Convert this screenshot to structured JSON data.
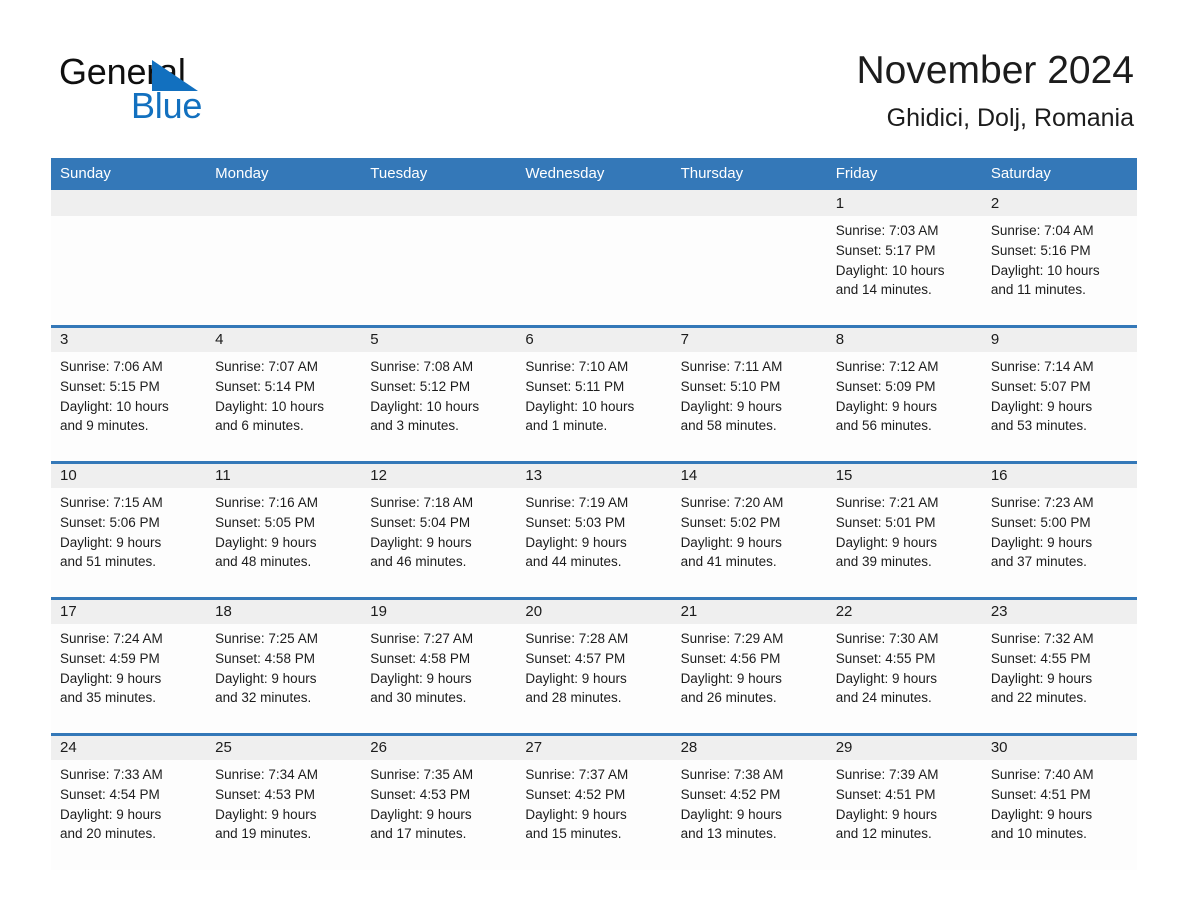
{
  "brand": {
    "name_part1": "General",
    "name_part2": "Blue",
    "triangle_color": "#1270bf",
    "text_color": "#0f0f0f"
  },
  "header": {
    "title": "November 2024",
    "location": "Ghidici, Dolj, Romania"
  },
  "colors": {
    "header_band": "#3478b8",
    "daynum_band": "#efefef",
    "cell_background": "#fdfdfd",
    "text": "#1c1c1c",
    "header_text": "#ffffff"
  },
  "weekday_headers": [
    "Sunday",
    "Monday",
    "Tuesday",
    "Wednesday",
    "Thursday",
    "Friday",
    "Saturday"
  ],
  "weeks": [
    {
      "days": [
        {
          "day": "",
          "sunrise": "",
          "sunset": "",
          "daylight1": "",
          "daylight2": ""
        },
        {
          "day": "",
          "sunrise": "",
          "sunset": "",
          "daylight1": "",
          "daylight2": ""
        },
        {
          "day": "",
          "sunrise": "",
          "sunset": "",
          "daylight1": "",
          "daylight2": ""
        },
        {
          "day": "",
          "sunrise": "",
          "sunset": "",
          "daylight1": "",
          "daylight2": ""
        },
        {
          "day": "",
          "sunrise": "",
          "sunset": "",
          "daylight1": "",
          "daylight2": ""
        },
        {
          "day": "1",
          "sunrise": "Sunrise: 7:03 AM",
          "sunset": "Sunset: 5:17 PM",
          "daylight1": "Daylight: 10 hours",
          "daylight2": "and 14 minutes."
        },
        {
          "day": "2",
          "sunrise": "Sunrise: 7:04 AM",
          "sunset": "Sunset: 5:16 PM",
          "daylight1": "Daylight: 10 hours",
          "daylight2": "and 11 minutes."
        }
      ]
    },
    {
      "days": [
        {
          "day": "3",
          "sunrise": "Sunrise: 7:06 AM",
          "sunset": "Sunset: 5:15 PM",
          "daylight1": "Daylight: 10 hours",
          "daylight2": "and 9 minutes."
        },
        {
          "day": "4",
          "sunrise": "Sunrise: 7:07 AM",
          "sunset": "Sunset: 5:14 PM",
          "daylight1": "Daylight: 10 hours",
          "daylight2": "and 6 minutes."
        },
        {
          "day": "5",
          "sunrise": "Sunrise: 7:08 AM",
          "sunset": "Sunset: 5:12 PM",
          "daylight1": "Daylight: 10 hours",
          "daylight2": "and 3 minutes."
        },
        {
          "day": "6",
          "sunrise": "Sunrise: 7:10 AM",
          "sunset": "Sunset: 5:11 PM",
          "daylight1": "Daylight: 10 hours",
          "daylight2": "and 1 minute."
        },
        {
          "day": "7",
          "sunrise": "Sunrise: 7:11 AM",
          "sunset": "Sunset: 5:10 PM",
          "daylight1": "Daylight: 9 hours",
          "daylight2": "and 58 minutes."
        },
        {
          "day": "8",
          "sunrise": "Sunrise: 7:12 AM",
          "sunset": "Sunset: 5:09 PM",
          "daylight1": "Daylight: 9 hours",
          "daylight2": "and 56 minutes."
        },
        {
          "day": "9",
          "sunrise": "Sunrise: 7:14 AM",
          "sunset": "Sunset: 5:07 PM",
          "daylight1": "Daylight: 9 hours",
          "daylight2": "and 53 minutes."
        }
      ]
    },
    {
      "days": [
        {
          "day": "10",
          "sunrise": "Sunrise: 7:15 AM",
          "sunset": "Sunset: 5:06 PM",
          "daylight1": "Daylight: 9 hours",
          "daylight2": "and 51 minutes."
        },
        {
          "day": "11",
          "sunrise": "Sunrise: 7:16 AM",
          "sunset": "Sunset: 5:05 PM",
          "daylight1": "Daylight: 9 hours",
          "daylight2": "and 48 minutes."
        },
        {
          "day": "12",
          "sunrise": "Sunrise: 7:18 AM",
          "sunset": "Sunset: 5:04 PM",
          "daylight1": "Daylight: 9 hours",
          "daylight2": "and 46 minutes."
        },
        {
          "day": "13",
          "sunrise": "Sunrise: 7:19 AM",
          "sunset": "Sunset: 5:03 PM",
          "daylight1": "Daylight: 9 hours",
          "daylight2": "and 44 minutes."
        },
        {
          "day": "14",
          "sunrise": "Sunrise: 7:20 AM",
          "sunset": "Sunset: 5:02 PM",
          "daylight1": "Daylight: 9 hours",
          "daylight2": "and 41 minutes."
        },
        {
          "day": "15",
          "sunrise": "Sunrise: 7:21 AM",
          "sunset": "Sunset: 5:01 PM",
          "daylight1": "Daylight: 9 hours",
          "daylight2": "and 39 minutes."
        },
        {
          "day": "16",
          "sunrise": "Sunrise: 7:23 AM",
          "sunset": "Sunset: 5:00 PM",
          "daylight1": "Daylight: 9 hours",
          "daylight2": "and 37 minutes."
        }
      ]
    },
    {
      "days": [
        {
          "day": "17",
          "sunrise": "Sunrise: 7:24 AM",
          "sunset": "Sunset: 4:59 PM",
          "daylight1": "Daylight: 9 hours",
          "daylight2": "and 35 minutes."
        },
        {
          "day": "18",
          "sunrise": "Sunrise: 7:25 AM",
          "sunset": "Sunset: 4:58 PM",
          "daylight1": "Daylight: 9 hours",
          "daylight2": "and 32 minutes."
        },
        {
          "day": "19",
          "sunrise": "Sunrise: 7:27 AM",
          "sunset": "Sunset: 4:58 PM",
          "daylight1": "Daylight: 9 hours",
          "daylight2": "and 30 minutes."
        },
        {
          "day": "20",
          "sunrise": "Sunrise: 7:28 AM",
          "sunset": "Sunset: 4:57 PM",
          "daylight1": "Daylight: 9 hours",
          "daylight2": "and 28 minutes."
        },
        {
          "day": "21",
          "sunrise": "Sunrise: 7:29 AM",
          "sunset": "Sunset: 4:56 PM",
          "daylight1": "Daylight: 9 hours",
          "daylight2": "and 26 minutes."
        },
        {
          "day": "22",
          "sunrise": "Sunrise: 7:30 AM",
          "sunset": "Sunset: 4:55 PM",
          "daylight1": "Daylight: 9 hours",
          "daylight2": "and 24 minutes."
        },
        {
          "day": "23",
          "sunrise": "Sunrise: 7:32 AM",
          "sunset": "Sunset: 4:55 PM",
          "daylight1": "Daylight: 9 hours",
          "daylight2": "and 22 minutes."
        }
      ]
    },
    {
      "days": [
        {
          "day": "24",
          "sunrise": "Sunrise: 7:33 AM",
          "sunset": "Sunset: 4:54 PM",
          "daylight1": "Daylight: 9 hours",
          "daylight2": "and 20 minutes."
        },
        {
          "day": "25",
          "sunrise": "Sunrise: 7:34 AM",
          "sunset": "Sunset: 4:53 PM",
          "daylight1": "Daylight: 9 hours",
          "daylight2": "and 19 minutes."
        },
        {
          "day": "26",
          "sunrise": "Sunrise: 7:35 AM",
          "sunset": "Sunset: 4:53 PM",
          "daylight1": "Daylight: 9 hours",
          "daylight2": "and 17 minutes."
        },
        {
          "day": "27",
          "sunrise": "Sunrise: 7:37 AM",
          "sunset": "Sunset: 4:52 PM",
          "daylight1": "Daylight: 9 hours",
          "daylight2": "and 15 minutes."
        },
        {
          "day": "28",
          "sunrise": "Sunrise: 7:38 AM",
          "sunset": "Sunset: 4:52 PM",
          "daylight1": "Daylight: 9 hours",
          "daylight2": "and 13 minutes."
        },
        {
          "day": "29",
          "sunrise": "Sunrise: 7:39 AM",
          "sunset": "Sunset: 4:51 PM",
          "daylight1": "Daylight: 9 hours",
          "daylight2": "and 12 minutes."
        },
        {
          "day": "30",
          "sunrise": "Sunrise: 7:40 AM",
          "sunset": "Sunset: 4:51 PM",
          "daylight1": "Daylight: 9 hours",
          "daylight2": "and 10 minutes."
        }
      ]
    }
  ]
}
